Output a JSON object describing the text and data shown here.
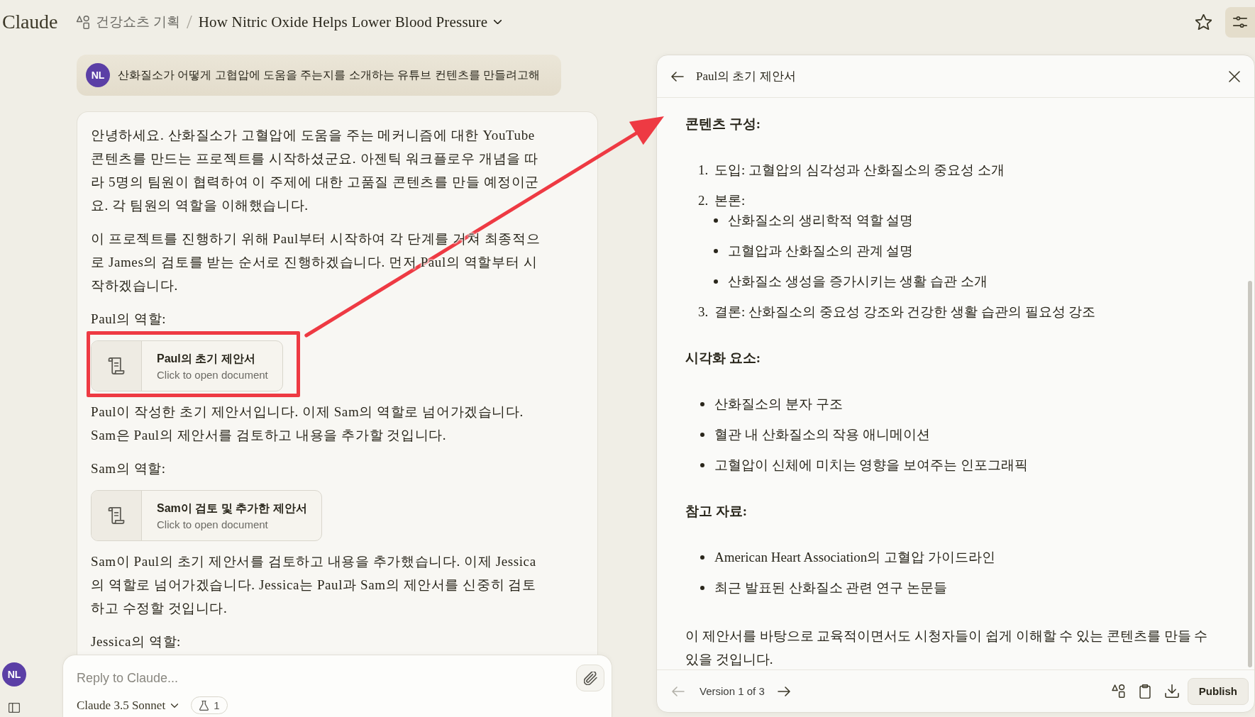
{
  "topbar": {
    "logo": "Claude",
    "project": "건강쇼츠 기획",
    "separator": "/",
    "title": "How Nitric Oxide Helps Lower Blood Pressure",
    "starred": false,
    "settings_active": true
  },
  "rail": {
    "avatar": "NL"
  },
  "user_message": {
    "avatar": "NL",
    "text": "산화질소가 어떻게 고협압에 도움을 주는지를 소개하는 유튜브 컨텐츠를 만들려고해"
  },
  "assistant_message": {
    "blocks": [
      {
        "kind": "paragraph",
        "text": "안녕하세요. 산화질소가 고혈압에 도움을 주는 메커니즘에 대한 YouTube 콘텐츠를 만드는 프로젝트를 시작하셨군요. 아젠틱 워크플로우 개념을 따라 5명의 팀원이 협력하여 이 주제에 대한 고품질 콘텐츠를 만들 예정이군요. 각 팀원의 역할을 이해했습니다."
      },
      {
        "kind": "paragraph",
        "text": "이 프로젝트를 진행하기 위해 Paul부터 시작하여 각 단계를 거쳐 최종적으로 James의 검토를 받는 순서로 진행하겠습니다. 먼저 Paul의 역할부터 시작하겠습니다."
      },
      {
        "kind": "paragraph",
        "text": "Paul의 역할:"
      },
      {
        "kind": "document",
        "title": "Paul의 초기 제안서",
        "subtitle": "Click to open document",
        "highlighted": true
      },
      {
        "kind": "paragraph",
        "text": "Paul이 작성한 초기 제안서입니다. 이제 Sam의 역할로 넘어가겠습니다. Sam은 Paul의 제안서를 검토하고 내용을 추가할 것입니다."
      },
      {
        "kind": "paragraph",
        "text": "Sam의 역할:"
      },
      {
        "kind": "document",
        "title": "Sam이 검토 및 추가한 제안서",
        "subtitle": "Click to open document",
        "highlighted": false
      },
      {
        "kind": "paragraph",
        "text": "Sam이 Paul의 초기 제안서를 검토하고 내용을 추가했습니다. 이제 Jessica의 역할로 넘어가겠습니다. Jessica는 Paul과 Sam의 제안서를 신중히 검토하고 수정할 것입니다."
      },
      {
        "kind": "paragraph",
        "text": "Jessica의 역할:"
      }
    ]
  },
  "reply_box": {
    "placeholder": "Reply to Claude...",
    "model": "Claude 3.5 Sonnet",
    "badge": "1"
  },
  "artifact": {
    "title": "Paul의 초기 제안서",
    "blocks": [
      {
        "kind": "heading",
        "text": "콘텐츠 구성:"
      },
      {
        "kind": "numbered",
        "items": [
          {
            "marker": "1.",
            "text": "도입: 고혈압의 심각성과 산화질소의 중요성 소개"
          },
          {
            "marker": "2.",
            "text": "본론:",
            "children": [
              {
                "text": "산화질소의 생리학적 역할 설명"
              },
              {
                "text": "고혈압과 산화질소의 관계 설명"
              },
              {
                "text": "산화질소 생성을 증가시키는 생활 습관 소개"
              }
            ]
          },
          {
            "marker": "3.",
            "text": "결론: 산화질소의 중요성 강조와 건강한 생활 습관의 필요성 강조"
          }
        ]
      },
      {
        "kind": "heading",
        "text": "시각화 요소:"
      },
      {
        "kind": "bulleted",
        "items": [
          {
            "text": "산화질소의 분자 구조"
          },
          {
            "text": "혈관 내 산화질소의 작용 애니메이션"
          },
          {
            "text": "고혈압이 신체에 미치는 영향을 보여주는 인포그래픽"
          }
        ]
      },
      {
        "kind": "heading",
        "text": "참고 자료:"
      },
      {
        "kind": "bulleted",
        "items": [
          {
            "text": "American Heart Association의 고혈압 가이드라인"
          },
          {
            "text": "최근 발표된 산화질소 관련 연구 논문들"
          }
        ]
      },
      {
        "kind": "paragraph",
        "text": "이 제안서를 바탕으로 교육적이면서도 시청자들이 쉽게 이해할 수 있는 콘텐츠를 만들 수 있을 것입니다."
      }
    ],
    "version": "Version 1 of 3",
    "previous_disabled": true,
    "next_disabled": false,
    "publish": "Publish"
  }
}
